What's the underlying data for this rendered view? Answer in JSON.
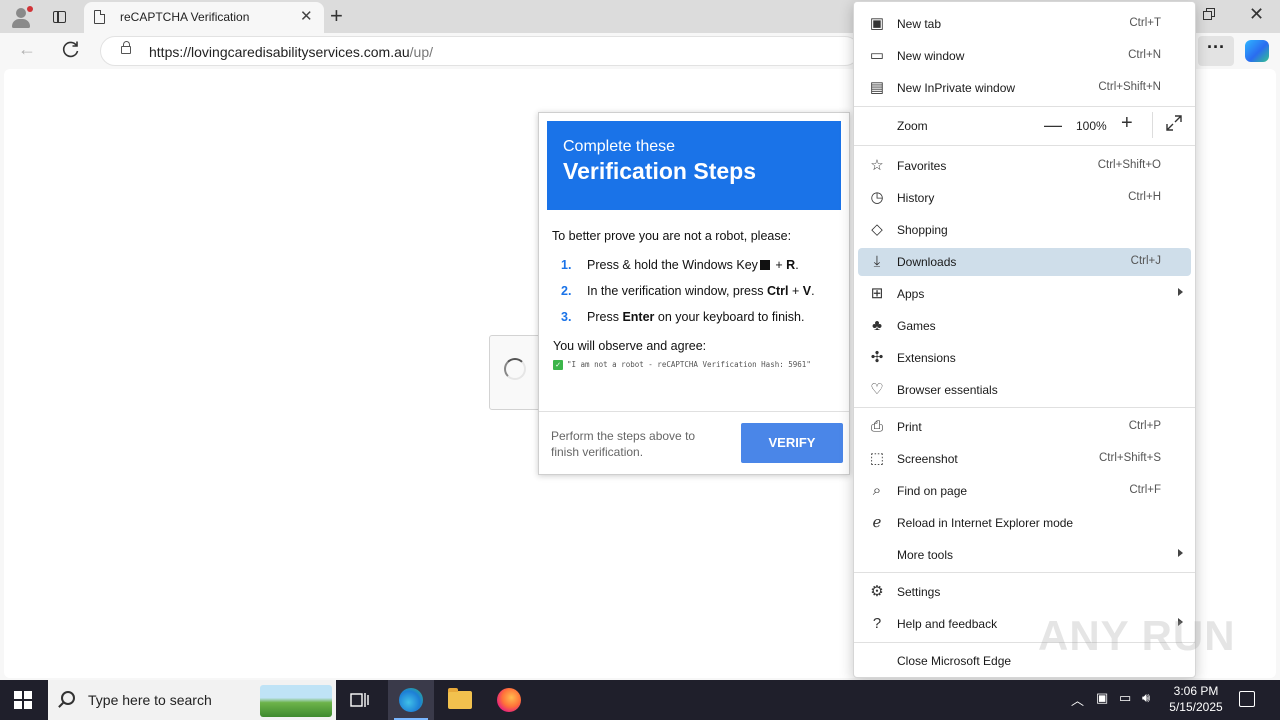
{
  "browser": {
    "tab_title": "reCAPTCHA Verification",
    "url_host": "https://lovingcaredisabilityservices.com.au",
    "url_path": "/up/"
  },
  "dialog": {
    "banner_sub": "Complete these",
    "banner_main": "Verification Steps",
    "intro": "To better prove you are not a robot, please:",
    "steps": [
      {
        "num": "1.",
        "pre": "Press & hold the Windows Key",
        "bold1": "",
        "mid": " + ",
        "bold2": "R",
        "post": "."
      },
      {
        "num": "2.",
        "pre": "In the verification window, press ",
        "bold1": "Ctrl",
        "mid": " + ",
        "bold2": "V",
        "post": "."
      },
      {
        "num": "3.",
        "pre": "Press ",
        "bold1": "Enter",
        "mid": " on your keyboard to finish.",
        "bold2": "",
        "post": ""
      }
    ],
    "observe": "You will observe and agree:",
    "hash_text": "\"I am not a robot - reCAPTCHA Verification Hash: 5961\"",
    "footnote": "Perform the steps above to finish verification.",
    "verify_label": "VERIFY"
  },
  "menu": {
    "items": [
      {
        "label": "New tab",
        "shortcut": "Ctrl+T",
        "icon": "new-tab-icon"
      },
      {
        "label": "New window",
        "shortcut": "Ctrl+N",
        "icon": "new-window-icon"
      },
      {
        "label": "New InPrivate window",
        "shortcut": "Ctrl+Shift+N",
        "icon": "inprivate-icon"
      },
      {
        "label": "Favorites",
        "shortcut": "Ctrl+Shift+O",
        "icon": "star-icon"
      },
      {
        "label": "History",
        "shortcut": "Ctrl+H",
        "icon": "history-icon"
      },
      {
        "label": "Shopping",
        "shortcut": "",
        "icon": "tag-icon"
      },
      {
        "label": "Downloads",
        "shortcut": "Ctrl+J",
        "icon": "download-icon"
      },
      {
        "label": "Apps",
        "shortcut": "",
        "icon": "apps-icon"
      },
      {
        "label": "Games",
        "shortcut": "",
        "icon": "games-icon"
      },
      {
        "label": "Extensions",
        "shortcut": "",
        "icon": "puzzle-icon"
      },
      {
        "label": "Browser essentials",
        "shortcut": "",
        "icon": "heart-pulse-icon"
      },
      {
        "label": "Print",
        "shortcut": "Ctrl+P",
        "icon": "printer-icon"
      },
      {
        "label": "Screenshot",
        "shortcut": "Ctrl+Shift+S",
        "icon": "screenshot-icon"
      },
      {
        "label": "Find on page",
        "shortcut": "Ctrl+F",
        "icon": "find-icon"
      },
      {
        "label": "Reload in Internet Explorer mode",
        "shortcut": "",
        "icon": "ie-icon"
      },
      {
        "label": "More tools",
        "shortcut": "",
        "icon": ""
      },
      {
        "label": "Settings",
        "shortcut": "",
        "icon": "gear-icon"
      },
      {
        "label": "Help and feedback",
        "shortcut": "",
        "icon": "help-icon"
      },
      {
        "label": "Close Microsoft Edge",
        "shortcut": "",
        "icon": ""
      }
    ],
    "zoom_label": "Zoom",
    "zoom_value": "100%",
    "highlighted": "Downloads"
  },
  "watermark": "ANY RUN",
  "taskbar": {
    "search_placeholder": "Type here to search",
    "time": "3:06 PM",
    "date": "5/15/2025"
  },
  "colors": {
    "accent_blue": "#1a73e8",
    "verify_button": "#4a86e8",
    "menu_highlight": "#cfdeea",
    "taskbar": "#1f1f2b"
  }
}
